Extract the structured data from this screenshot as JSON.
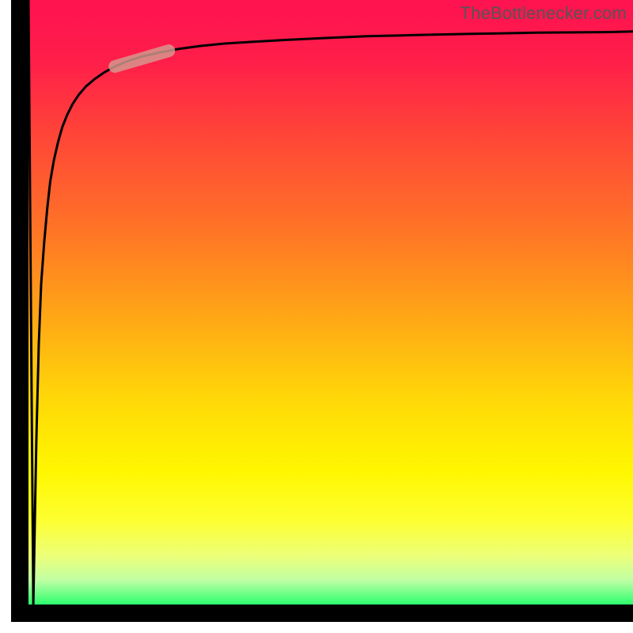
{
  "attribution": "TheBottlenecker.com",
  "colors": {
    "curve": "#000000",
    "highlight": "#d59b90",
    "axis": "#000000"
  },
  "chart_data": {
    "type": "line",
    "title": "",
    "xlabel": "",
    "ylabel": "",
    "xlim": [
      0,
      100
    ],
    "ylim": [
      0,
      100
    ],
    "x": [
      0.0,
      0.8,
      1.3,
      1.7,
      2.1,
      2.6,
      3.1,
      3.6,
      4.2,
      4.9,
      5.6,
      6.4,
      7.3,
      8.3,
      9.5,
      10.9,
      12.5,
      14.3,
      16.4,
      18.9,
      21.6,
      24.8,
      28.4,
      32.5,
      37.3,
      42.7,
      48.9,
      56.0,
      64.1,
      73.4,
      84.1,
      96.3,
      100.0
    ],
    "values": [
      100.0,
      0.0,
      27.0,
      43.0,
      53.0,
      60.0,
      65.5,
      70.0,
      73.5,
      76.5,
      79.0,
      81.0,
      82.8,
      84.3,
      85.7,
      86.9,
      88.0,
      89.0,
      89.9,
      90.7,
      91.3,
      91.9,
      92.4,
      92.8,
      93.1,
      93.4,
      93.7,
      94.0,
      94.2,
      94.4,
      94.6,
      94.7,
      94.8
    ],
    "highlight_segment_x": [
      14.3,
      23.2
    ],
    "highlight_segment_y": [
      89.0,
      91.6
    ],
    "gradient_background": true
  }
}
